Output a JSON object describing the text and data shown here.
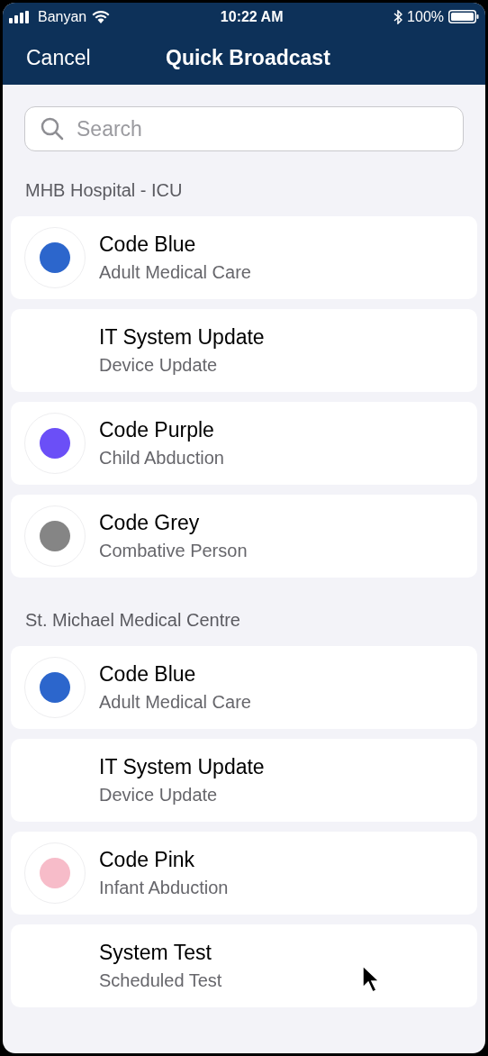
{
  "status_bar": {
    "carrier": "Banyan",
    "time": "10:22 AM",
    "battery": "100%"
  },
  "nav": {
    "cancel": "Cancel",
    "title": "Quick Broadcast"
  },
  "search": {
    "placeholder": "Search"
  },
  "sections": [
    {
      "title": "MHB Hospital - ICU",
      "items": [
        {
          "title": "Code Blue",
          "subtitle": "Adult Medical Care",
          "color": "#2c66cc"
        },
        {
          "title": "IT System Update",
          "subtitle": "Device Update"
        },
        {
          "title": "Code Purple",
          "subtitle": "Child Abduction",
          "color": "#6b4ff7"
        },
        {
          "title": "Code Grey",
          "subtitle": "Combative Person",
          "color": "#858585"
        }
      ]
    },
    {
      "title": "St. Michael Medical Centre",
      "items": [
        {
          "title": "Code Blue",
          "subtitle": "Adult Medical Care",
          "color": "#2c66cc"
        },
        {
          "title": "IT System Update",
          "subtitle": "Device Update"
        },
        {
          "title": "Code Pink",
          "subtitle": "Infant Abduction",
          "color": "#f7bcc9"
        },
        {
          "title": "System Test",
          "subtitle": "Scheduled Test"
        }
      ]
    }
  ]
}
